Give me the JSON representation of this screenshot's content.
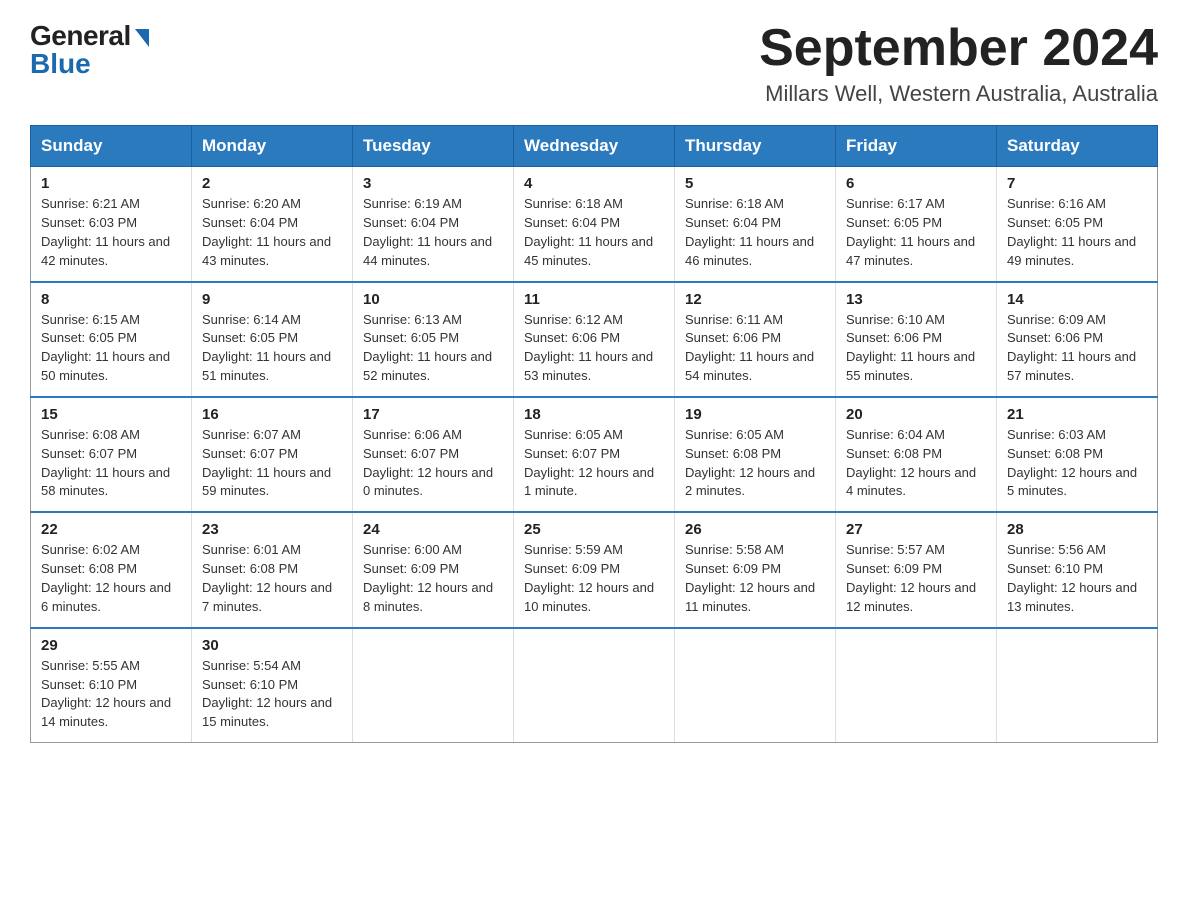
{
  "logo": {
    "general": "General",
    "blue": "Blue"
  },
  "title": "September 2024",
  "location": "Millars Well, Western Australia, Australia",
  "days_of_week": [
    "Sunday",
    "Monday",
    "Tuesday",
    "Wednesday",
    "Thursday",
    "Friday",
    "Saturday"
  ],
  "weeks": [
    [
      {
        "day": "1",
        "sunrise": "6:21 AM",
        "sunset": "6:03 PM",
        "daylight": "11 hours and 42 minutes."
      },
      {
        "day": "2",
        "sunrise": "6:20 AM",
        "sunset": "6:04 PM",
        "daylight": "11 hours and 43 minutes."
      },
      {
        "day": "3",
        "sunrise": "6:19 AM",
        "sunset": "6:04 PM",
        "daylight": "11 hours and 44 minutes."
      },
      {
        "day": "4",
        "sunrise": "6:18 AM",
        "sunset": "6:04 PM",
        "daylight": "11 hours and 45 minutes."
      },
      {
        "day": "5",
        "sunrise": "6:18 AM",
        "sunset": "6:04 PM",
        "daylight": "11 hours and 46 minutes."
      },
      {
        "day": "6",
        "sunrise": "6:17 AM",
        "sunset": "6:05 PM",
        "daylight": "11 hours and 47 minutes."
      },
      {
        "day": "7",
        "sunrise": "6:16 AM",
        "sunset": "6:05 PM",
        "daylight": "11 hours and 49 minutes."
      }
    ],
    [
      {
        "day": "8",
        "sunrise": "6:15 AM",
        "sunset": "6:05 PM",
        "daylight": "11 hours and 50 minutes."
      },
      {
        "day": "9",
        "sunrise": "6:14 AM",
        "sunset": "6:05 PM",
        "daylight": "11 hours and 51 minutes."
      },
      {
        "day": "10",
        "sunrise": "6:13 AM",
        "sunset": "6:05 PM",
        "daylight": "11 hours and 52 minutes."
      },
      {
        "day": "11",
        "sunrise": "6:12 AM",
        "sunset": "6:06 PM",
        "daylight": "11 hours and 53 minutes."
      },
      {
        "day": "12",
        "sunrise": "6:11 AM",
        "sunset": "6:06 PM",
        "daylight": "11 hours and 54 minutes."
      },
      {
        "day": "13",
        "sunrise": "6:10 AM",
        "sunset": "6:06 PM",
        "daylight": "11 hours and 55 minutes."
      },
      {
        "day": "14",
        "sunrise": "6:09 AM",
        "sunset": "6:06 PM",
        "daylight": "11 hours and 57 minutes."
      }
    ],
    [
      {
        "day": "15",
        "sunrise": "6:08 AM",
        "sunset": "6:07 PM",
        "daylight": "11 hours and 58 minutes."
      },
      {
        "day": "16",
        "sunrise": "6:07 AM",
        "sunset": "6:07 PM",
        "daylight": "11 hours and 59 minutes."
      },
      {
        "day": "17",
        "sunrise": "6:06 AM",
        "sunset": "6:07 PM",
        "daylight": "12 hours and 0 minutes."
      },
      {
        "day": "18",
        "sunrise": "6:05 AM",
        "sunset": "6:07 PM",
        "daylight": "12 hours and 1 minute."
      },
      {
        "day": "19",
        "sunrise": "6:05 AM",
        "sunset": "6:08 PM",
        "daylight": "12 hours and 2 minutes."
      },
      {
        "day": "20",
        "sunrise": "6:04 AM",
        "sunset": "6:08 PM",
        "daylight": "12 hours and 4 minutes."
      },
      {
        "day": "21",
        "sunrise": "6:03 AM",
        "sunset": "6:08 PM",
        "daylight": "12 hours and 5 minutes."
      }
    ],
    [
      {
        "day": "22",
        "sunrise": "6:02 AM",
        "sunset": "6:08 PM",
        "daylight": "12 hours and 6 minutes."
      },
      {
        "day": "23",
        "sunrise": "6:01 AM",
        "sunset": "6:08 PM",
        "daylight": "12 hours and 7 minutes."
      },
      {
        "day": "24",
        "sunrise": "6:00 AM",
        "sunset": "6:09 PM",
        "daylight": "12 hours and 8 minutes."
      },
      {
        "day": "25",
        "sunrise": "5:59 AM",
        "sunset": "6:09 PM",
        "daylight": "12 hours and 10 minutes."
      },
      {
        "day": "26",
        "sunrise": "5:58 AM",
        "sunset": "6:09 PM",
        "daylight": "12 hours and 11 minutes."
      },
      {
        "day": "27",
        "sunrise": "5:57 AM",
        "sunset": "6:09 PM",
        "daylight": "12 hours and 12 minutes."
      },
      {
        "day": "28",
        "sunrise": "5:56 AM",
        "sunset": "6:10 PM",
        "daylight": "12 hours and 13 minutes."
      }
    ],
    [
      {
        "day": "29",
        "sunrise": "5:55 AM",
        "sunset": "6:10 PM",
        "daylight": "12 hours and 14 minutes."
      },
      {
        "day": "30",
        "sunrise": "5:54 AM",
        "sunset": "6:10 PM",
        "daylight": "12 hours and 15 minutes."
      },
      null,
      null,
      null,
      null,
      null
    ]
  ],
  "labels": {
    "sunrise": "Sunrise:",
    "sunset": "Sunset:",
    "daylight": "Daylight:"
  }
}
